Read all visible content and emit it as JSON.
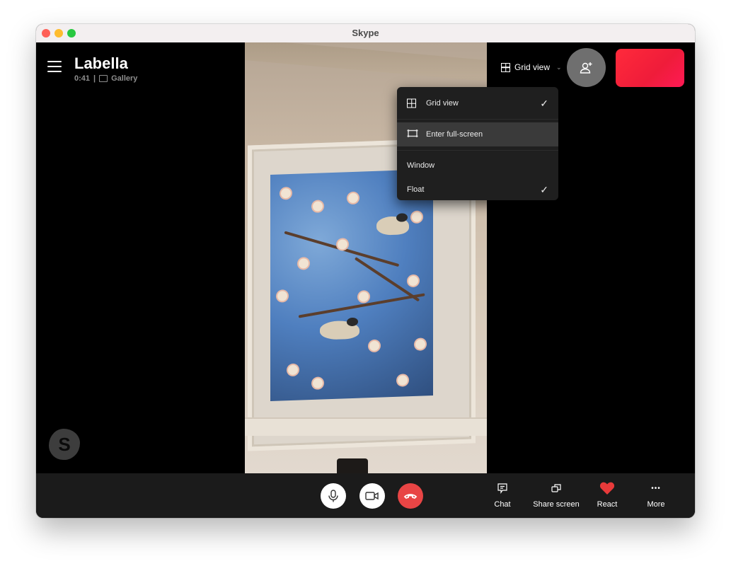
{
  "window": {
    "title": "Skype"
  },
  "call": {
    "contact_name": "Labella",
    "duration": "0:41",
    "separator": "|",
    "view_mode": "Gallery"
  },
  "header": {
    "view_toggle_label": "Grid view",
    "chevron": "⌄"
  },
  "view_menu": {
    "items": [
      {
        "label": "Grid view",
        "icon": "grid-icon",
        "checked": true,
        "check": "✓"
      },
      {
        "label": "Enter full-screen",
        "icon": "fullscreen-icon",
        "checked": false,
        "highlighted": true
      },
      {
        "label": "Window",
        "checked": false
      },
      {
        "label": "Float",
        "checked": true,
        "check": "✓"
      }
    ]
  },
  "logo": {
    "letter": "S"
  },
  "controls": {
    "mic": "microphone",
    "camera": "video-camera",
    "end_call": "end-call",
    "actions": [
      {
        "label": "Chat",
        "icon": "chat-icon"
      },
      {
        "label": "Share screen",
        "icon": "share-screen-icon"
      },
      {
        "label": "React",
        "icon": "heart-icon"
      },
      {
        "label": "More",
        "icon": "more-icon",
        "glyph": "•••"
      }
    ]
  },
  "colors": {
    "end_call": "#e84545",
    "react_heart": "#e83a3a",
    "self_view": "#ff2a3b",
    "menu_bg": "#1f1f1f",
    "menu_highlight": "#3a3a3a"
  }
}
